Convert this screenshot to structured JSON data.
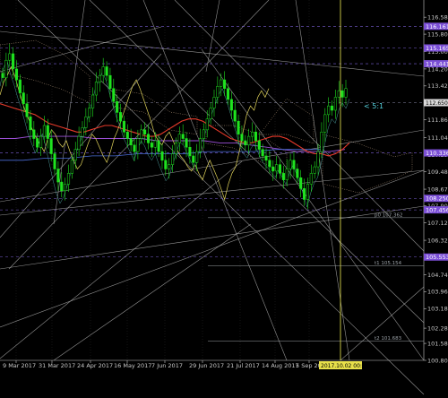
{
  "chart_data": {
    "type": "candlestick",
    "symbol_hint": "USDJPY daily",
    "ylim": [
      100.8,
      117.37
    ],
    "y_ticks": [
      "116.580",
      "115.800",
      "115.000",
      "114.200",
      "113.420",
      "112.600",
      "111.860",
      "111.040",
      "110.250",
      "109.480",
      "108.670",
      "107.900",
      "107.120",
      "106.320",
      "105.560",
      "104.740",
      "103.960",
      "103.180",
      "102.280",
      "101.580",
      "100.800"
    ],
    "x_tick_labels": [
      "9 Mar 2017",
      "31 Mar 2017",
      "24 Apr 2017",
      "16 May 2017",
      "7 Jun 2017",
      "29 Jun 2017",
      "21 Jul 2017",
      "14 Aug 2017",
      "5 Sep 2017"
    ],
    "time_marker_label": "2017.10.02 00:00",
    "current_price": "112.650",
    "price_labels": [
      {
        "text": "116.161",
        "value": 116.16,
        "color": "#7b4fd6"
      },
      {
        "text": "115.165",
        "value": 115.165,
        "color": "#7b4fd6"
      },
      {
        "text": "114.441",
        "value": 114.44,
        "color": "#7b4fd6"
      },
      {
        "text": "112.650",
        "value": 112.65,
        "color": "#7b4fd6"
      },
      {
        "text": "110.336",
        "value": 110.34,
        "color": "#7b4fd6"
      },
      {
        "text": "108.250",
        "value": 108.25,
        "color": "#7b4fd6"
      },
      {
        "text": "107.456",
        "value": 107.72,
        "color": "#7b4fd6"
      },
      {
        "text": "105.553",
        "value": 105.55,
        "color": "#7b4fd6"
      }
    ],
    "object_labels": [
      {
        "text": "p0 107.362",
        "value": 107.36
      },
      {
        "text": "t1 105.154",
        "value": 105.15
      },
      {
        "text": "t2 101.683",
        "value": 101.68
      }
    ],
    "annotation": "< 5:1",
    "series_closes": [
      113.8,
      114.6,
      114.9,
      114.2,
      113.7,
      113.1,
      112.6,
      112.0,
      111.4,
      111.0,
      110.6,
      111.1,
      111.6,
      111.0,
      110.3,
      109.6,
      109.0,
      108.6,
      108.9,
      109.4,
      110.0,
      110.5,
      111.1,
      111.5,
      112.0,
      112.4,
      113.0,
      113.6,
      113.9,
      114.3,
      113.9,
      113.3,
      112.7,
      112.2,
      111.8,
      111.3,
      111.0,
      110.7,
      110.4,
      111.0,
      111.4,
      111.2,
      110.8,
      110.6,
      110.9,
      110.4,
      110.0,
      109.6,
      109.8,
      110.3,
      110.8,
      111.2,
      111.0,
      110.6,
      110.2,
      109.9,
      110.4,
      111.0,
      111.4,
      111.9,
      112.4,
      112.9,
      113.4,
      113.7,
      113.3,
      112.8,
      112.3,
      111.8,
      111.2,
      110.9,
      110.7,
      111.1,
      111.3,
      110.9,
      110.5,
      110.2,
      110.0,
      109.7,
      109.5,
      109.8,
      109.4,
      109.1,
      109.6,
      110.0,
      109.6,
      109.2,
      108.7,
      108.2,
      108.9,
      109.4,
      109.7,
      110.4,
      111.3,
      112.1,
      112.5,
      112.3,
      112.9,
      113.2,
      112.9,
      113.3
    ],
    "ma_red": [
      112.6,
      112.5,
      112.4,
      112.3,
      112.2,
      112.1,
      111.9,
      111.7,
      111.6,
      111.5,
      111.4,
      111.3,
      111.3,
      111.4,
      111.5,
      111.6,
      111.6,
      111.5,
      111.4,
      111.3,
      111.2,
      111.1,
      111.1,
      111.2,
      111.4,
      111.6,
      111.8,
      111.9,
      111.9,
      111.8,
      111.6,
      111.4,
      111.2,
      111.0,
      110.9,
      110.8,
      110.8,
      110.9,
      111.0,
      111.1,
      111.1,
      111.0,
      110.8,
      110.6,
      110.4,
      110.3,
      110.3,
      110.2,
      110.3,
      110.5,
      110.8
    ],
    "ma_purple": [
      111.0,
      111.0,
      111.1,
      111.1,
      111.1,
      111.1,
      111.0,
      111.0,
      111.0,
      111.0,
      110.9,
      110.9,
      110.9,
      110.9,
      110.8,
      110.8,
      110.7,
      110.6,
      110.5,
      110.4,
      110.4,
      110.4,
      110.5
    ],
    "ma_blue": [
      110.0,
      110.0,
      110.1,
      110.1,
      110.2,
      110.2,
      110.3,
      110.3,
      110.3,
      110.4,
      110.4,
      110.4,
      110.5,
      110.5,
      110.5
    ]
  }
}
